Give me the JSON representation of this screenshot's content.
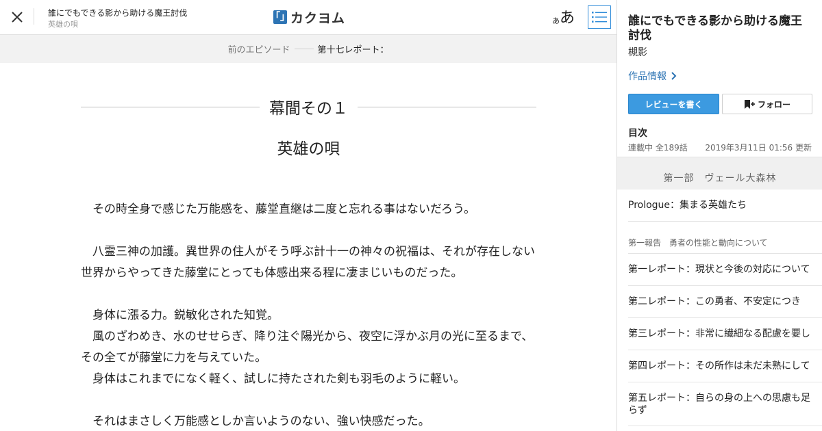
{
  "header": {
    "work_title": "誰にでもできる影から助ける魔王討伐",
    "episode_subtitle": "英雄の唄",
    "logo_text": "カクヨム",
    "logo_mark": "「」",
    "font_small": "あ",
    "font_large": "あ"
  },
  "nav": {
    "prev_label": "前のエピソード",
    "prev_title": "第十七レポート："
  },
  "content": {
    "chapter_title": "幕間その１",
    "episode_title": "英雄の唄",
    "paragraphs": [
      "　その時全身で感じた万能感を、藤堂直継は二度と忘れる事はないだろう。",
      "",
      "　八霊三神の加護。異世界の住人がそう呼ぶ計十一の神々の祝福は、それが存在しない世界からやってきた藤堂にとっても体感出来る程に凄まじいものだった。",
      "",
      "　身体に漲る力。鋭敏化された知覚。",
      "　風のざわめき、水のせせらぎ、降り注ぐ陽光から、夜空に浮かぶ月の光に至るまで、その全てが藤堂に力を与えていた。",
      "　身体はこれまでになく軽く、試しに持たされた剣も羽毛のように軽い。",
      "",
      "　それはまさしく万能感としか言いようのない、強い快感だった。"
    ]
  },
  "sidebar": {
    "title": "誰にでもできる影から助ける魔王討伐",
    "author": "槻影",
    "work_info": "作品情報",
    "review_button": "レビューを書く",
    "follow_button": "フォロー",
    "toc_label": "目次",
    "status": "連載中 全189話",
    "updated": "2019年3月11日 01:56 更新",
    "part_title": "第一部　ヴェール大森林",
    "prologue": "Prologue：集まる英雄たち",
    "section_title": "第一報告　勇者の性能と動向について",
    "episodes": [
      "第一レポート：現状と今後の対応について",
      "第二レポート：この勇者、不安定につき",
      "第三レポート：非常に繊細なる配慮を要し",
      "第四レポート：その所作は未だ未熟にして",
      "第五レポート：自らの身の上への思慮も足らず"
    ]
  },
  "colors": {
    "accent": "#2d74b4",
    "review_button": "#3c9ae0",
    "nav_background": "#f2f2f2"
  },
  "icons": {
    "close": "close-icon",
    "toc": "list-icon",
    "chevron": "chevron-right-icon",
    "follow": "bookmark-plus-icon"
  }
}
